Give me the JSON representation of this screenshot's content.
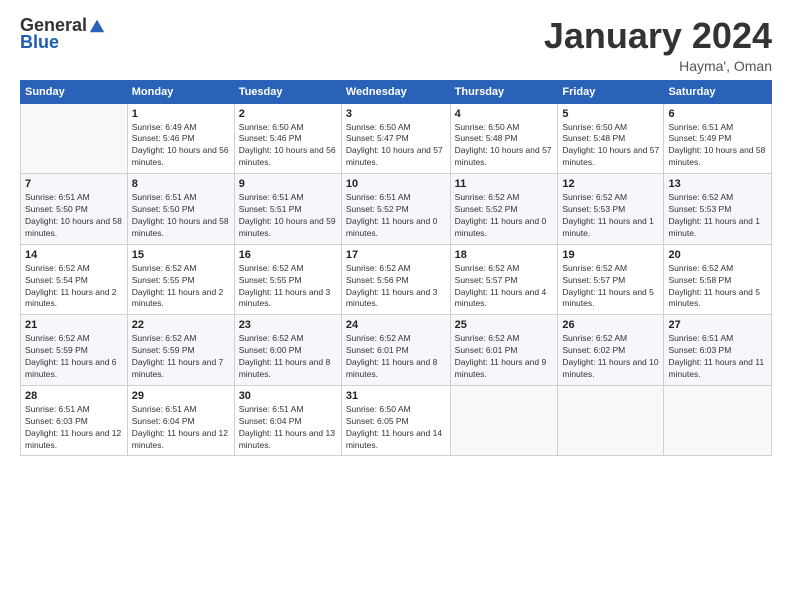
{
  "logo": {
    "general": "General",
    "blue": "Blue"
  },
  "header": {
    "month": "January 2024",
    "location": "Hayma', Oman"
  },
  "days_of_week": [
    "Sunday",
    "Monday",
    "Tuesday",
    "Wednesday",
    "Thursday",
    "Friday",
    "Saturday"
  ],
  "weeks": [
    [
      {
        "day": "",
        "sunrise": "",
        "sunset": "",
        "daylight": ""
      },
      {
        "day": "1",
        "sunrise": "Sunrise: 6:49 AM",
        "sunset": "Sunset: 5:46 PM",
        "daylight": "Daylight: 10 hours and 56 minutes."
      },
      {
        "day": "2",
        "sunrise": "Sunrise: 6:50 AM",
        "sunset": "Sunset: 5:46 PM",
        "daylight": "Daylight: 10 hours and 56 minutes."
      },
      {
        "day": "3",
        "sunrise": "Sunrise: 6:50 AM",
        "sunset": "Sunset: 5:47 PM",
        "daylight": "Daylight: 10 hours and 57 minutes."
      },
      {
        "day": "4",
        "sunrise": "Sunrise: 6:50 AM",
        "sunset": "Sunset: 5:48 PM",
        "daylight": "Daylight: 10 hours and 57 minutes."
      },
      {
        "day": "5",
        "sunrise": "Sunrise: 6:50 AM",
        "sunset": "Sunset: 5:48 PM",
        "daylight": "Daylight: 10 hours and 57 minutes."
      },
      {
        "day": "6",
        "sunrise": "Sunrise: 6:51 AM",
        "sunset": "Sunset: 5:49 PM",
        "daylight": "Daylight: 10 hours and 58 minutes."
      }
    ],
    [
      {
        "day": "7",
        "sunrise": "Sunrise: 6:51 AM",
        "sunset": "Sunset: 5:50 PM",
        "daylight": "Daylight: 10 hours and 58 minutes."
      },
      {
        "day": "8",
        "sunrise": "Sunrise: 6:51 AM",
        "sunset": "Sunset: 5:50 PM",
        "daylight": "Daylight: 10 hours and 58 minutes."
      },
      {
        "day": "9",
        "sunrise": "Sunrise: 6:51 AM",
        "sunset": "Sunset: 5:51 PM",
        "daylight": "Daylight: 10 hours and 59 minutes."
      },
      {
        "day": "10",
        "sunrise": "Sunrise: 6:51 AM",
        "sunset": "Sunset: 5:52 PM",
        "daylight": "Daylight: 11 hours and 0 minutes."
      },
      {
        "day": "11",
        "sunrise": "Sunrise: 6:52 AM",
        "sunset": "Sunset: 5:52 PM",
        "daylight": "Daylight: 11 hours and 0 minutes."
      },
      {
        "day": "12",
        "sunrise": "Sunrise: 6:52 AM",
        "sunset": "Sunset: 5:53 PM",
        "daylight": "Daylight: 11 hours and 1 minute."
      },
      {
        "day": "13",
        "sunrise": "Sunrise: 6:52 AM",
        "sunset": "Sunset: 5:53 PM",
        "daylight": "Daylight: 11 hours and 1 minute."
      }
    ],
    [
      {
        "day": "14",
        "sunrise": "Sunrise: 6:52 AM",
        "sunset": "Sunset: 5:54 PM",
        "daylight": "Daylight: 11 hours and 2 minutes."
      },
      {
        "day": "15",
        "sunrise": "Sunrise: 6:52 AM",
        "sunset": "Sunset: 5:55 PM",
        "daylight": "Daylight: 11 hours and 2 minutes."
      },
      {
        "day": "16",
        "sunrise": "Sunrise: 6:52 AM",
        "sunset": "Sunset: 5:55 PM",
        "daylight": "Daylight: 11 hours and 3 minutes."
      },
      {
        "day": "17",
        "sunrise": "Sunrise: 6:52 AM",
        "sunset": "Sunset: 5:56 PM",
        "daylight": "Daylight: 11 hours and 3 minutes."
      },
      {
        "day": "18",
        "sunrise": "Sunrise: 6:52 AM",
        "sunset": "Sunset: 5:57 PM",
        "daylight": "Daylight: 11 hours and 4 minutes."
      },
      {
        "day": "19",
        "sunrise": "Sunrise: 6:52 AM",
        "sunset": "Sunset: 5:57 PM",
        "daylight": "Daylight: 11 hours and 5 minutes."
      },
      {
        "day": "20",
        "sunrise": "Sunrise: 6:52 AM",
        "sunset": "Sunset: 5:58 PM",
        "daylight": "Daylight: 11 hours and 5 minutes."
      }
    ],
    [
      {
        "day": "21",
        "sunrise": "Sunrise: 6:52 AM",
        "sunset": "Sunset: 5:59 PM",
        "daylight": "Daylight: 11 hours and 6 minutes."
      },
      {
        "day": "22",
        "sunrise": "Sunrise: 6:52 AM",
        "sunset": "Sunset: 5:59 PM",
        "daylight": "Daylight: 11 hours and 7 minutes."
      },
      {
        "day": "23",
        "sunrise": "Sunrise: 6:52 AM",
        "sunset": "Sunset: 6:00 PM",
        "daylight": "Daylight: 11 hours and 8 minutes."
      },
      {
        "day": "24",
        "sunrise": "Sunrise: 6:52 AM",
        "sunset": "Sunset: 6:01 PM",
        "daylight": "Daylight: 11 hours and 8 minutes."
      },
      {
        "day": "25",
        "sunrise": "Sunrise: 6:52 AM",
        "sunset": "Sunset: 6:01 PM",
        "daylight": "Daylight: 11 hours and 9 minutes."
      },
      {
        "day": "26",
        "sunrise": "Sunrise: 6:52 AM",
        "sunset": "Sunset: 6:02 PM",
        "daylight": "Daylight: 11 hours and 10 minutes."
      },
      {
        "day": "27",
        "sunrise": "Sunrise: 6:51 AM",
        "sunset": "Sunset: 6:03 PM",
        "daylight": "Daylight: 11 hours and 11 minutes."
      }
    ],
    [
      {
        "day": "28",
        "sunrise": "Sunrise: 6:51 AM",
        "sunset": "Sunset: 6:03 PM",
        "daylight": "Daylight: 11 hours and 12 minutes."
      },
      {
        "day": "29",
        "sunrise": "Sunrise: 6:51 AM",
        "sunset": "Sunset: 6:04 PM",
        "daylight": "Daylight: 11 hours and 12 minutes."
      },
      {
        "day": "30",
        "sunrise": "Sunrise: 6:51 AM",
        "sunset": "Sunset: 6:04 PM",
        "daylight": "Daylight: 11 hours and 13 minutes."
      },
      {
        "day": "31",
        "sunrise": "Sunrise: 6:50 AM",
        "sunset": "Sunset: 6:05 PM",
        "daylight": "Daylight: 11 hours and 14 minutes."
      },
      {
        "day": "",
        "sunrise": "",
        "sunset": "",
        "daylight": ""
      },
      {
        "day": "",
        "sunrise": "",
        "sunset": "",
        "daylight": ""
      },
      {
        "day": "",
        "sunrise": "",
        "sunset": "",
        "daylight": ""
      }
    ]
  ]
}
